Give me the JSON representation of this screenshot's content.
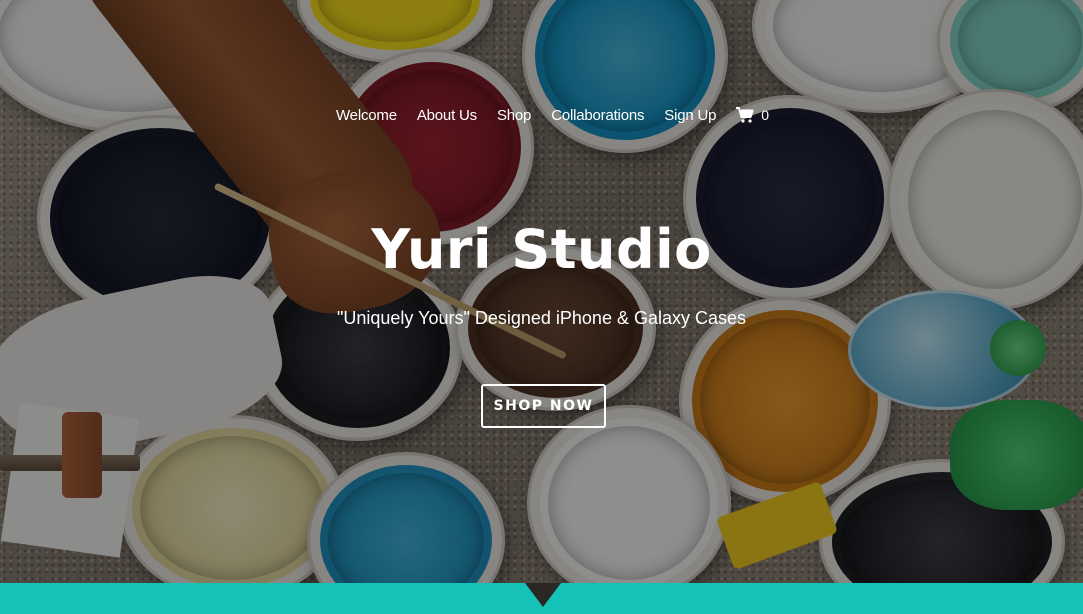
{
  "nav": {
    "items": [
      {
        "label": "Welcome"
      },
      {
        "label": "About Us"
      },
      {
        "label": "Shop"
      },
      {
        "label": "Collaborations"
      },
      {
        "label": "Sign Up"
      }
    ],
    "cart_icon": "shopping-cart-icon",
    "cart_count": "0"
  },
  "hero": {
    "title": "Yuri Studio",
    "subtitle": "\"Uniquely Yours\" Designed iPhone & Galaxy Cases",
    "cta_label": "SHOP NOW"
  },
  "colors": {
    "accent_band": "#15c3b8",
    "text": "#ffffff"
  }
}
